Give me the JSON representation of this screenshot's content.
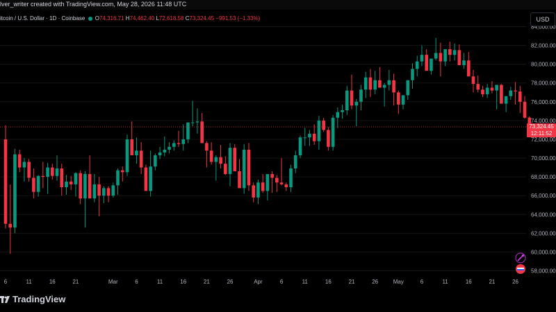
{
  "header": {
    "credit": "lver_writer created with TradingView.com, May 28, 2026 11:48 UTC"
  },
  "legend": {
    "symbol": "itcoin / U.S. Dollar · 1D · Coinbase",
    "o_label": "O",
    "o_value": "74,316.71",
    "h_label": "H",
    "h_value": "74,462.40",
    "l_label": "L",
    "l_value": "72,618.58",
    "c_label": "C",
    "c_value": "73,324.45",
    "change": "−991.53 (−1.33%)"
  },
  "currency": "USD",
  "price_box": {
    "price": "73,324.45",
    "countdown": "12:11:52"
  },
  "brand": {
    "name": "TradingView"
  },
  "colors": {
    "up": "#089981",
    "down": "#f23645",
    "background": "#000000",
    "text": "#d1d4dc"
  },
  "icons": [
    "tradingview-logo-icon",
    "magic-wand-icon",
    "flag-icon"
  ],
  "chart_data": {
    "type": "candlestick",
    "yaxis_ticks": [
      "84,000.00",
      "82,000.00",
      "80,000.00",
      "78,000.00",
      "76,000.00",
      "74,000.00",
      "72,000.00",
      "70,000.00",
      "68,000.00",
      "66,000.00",
      "64,000.00",
      "62,000.00",
      "60,000.00",
      "58,000.00"
    ],
    "yaxis_values": [
      84000,
      82000,
      80000,
      78000,
      76000,
      74000,
      72000,
      70000,
      68000,
      66000,
      64000,
      62000,
      60000,
      58000
    ],
    "ylim": [
      57300,
      84300
    ],
    "xaxis_ticks": [
      {
        "label": "6",
        "idx": 0
      },
      {
        "label": "11",
        "idx": 5
      },
      {
        "label": "16",
        "idx": 10
      },
      {
        "label": "21",
        "idx": 15
      },
      {
        "label": "Mar",
        "idx": 23
      },
      {
        "label": "6",
        "idx": 28
      },
      {
        "label": "11",
        "idx": 33
      },
      {
        "label": "16",
        "idx": 38
      },
      {
        "label": "21",
        "idx": 43
      },
      {
        "label": "26",
        "idx": 48
      },
      {
        "label": "Apr",
        "idx": 54
      },
      {
        "label": "6",
        "idx": 59
      },
      {
        "label": "11",
        "idx": 64
      },
      {
        "label": "16",
        "idx": 69
      },
      {
        "label": "21",
        "idx": 74
      },
      {
        "label": "26",
        "idx": 79
      },
      {
        "label": "May",
        "idx": 84
      },
      {
        "label": "6",
        "idx": 89
      },
      {
        "label": "11",
        "idx": 94
      },
      {
        "label": "16",
        "idx": 99
      },
      {
        "label": "21",
        "idx": 104
      },
      {
        "label": "26",
        "idx": 109
      }
    ],
    "last_price": 73324.45,
    "candles": [
      [
        72000,
        73500,
        62500,
        63000
      ],
      [
        63000,
        67200,
        59800,
        62600
      ],
      [
        62600,
        71000,
        62000,
        70400
      ],
      [
        70400,
        70900,
        68500,
        69000
      ],
      [
        69000,
        70000,
        67500,
        69600
      ],
      [
        69600,
        69900,
        67500,
        67900
      ],
      [
        67900,
        68900,
        65700,
        66400
      ],
      [
        66400,
        68200,
        65900,
        68100
      ],
      [
        68100,
        69600,
        66800,
        68000
      ],
      [
        68000,
        69500,
        66200,
        69000
      ],
      [
        69000,
        69400,
        67700,
        68100
      ],
      [
        68100,
        70300,
        67600,
        68900
      ],
      [
        68900,
        69400,
        66000,
        66900
      ],
      [
        66900,
        68200,
        66100,
        67500
      ],
      [
        67500,
        68100,
        66600,
        67200
      ],
      [
        67200,
        68500,
        65900,
        68400
      ],
      [
        68400,
        68700,
        65100,
        65700
      ],
      [
        65700,
        68600,
        62600,
        68300
      ],
      [
        68300,
        70300,
        65800,
        65700
      ],
      [
        65700,
        68300,
        65300,
        67200
      ],
      [
        67200,
        68000,
        63800,
        66000
      ],
      [
        66000,
        67000,
        65200,
        66800
      ],
      [
        66800,
        67000,
        65300,
        66000
      ],
      [
        66000,
        67400,
        65800,
        67100
      ],
      [
        67100,
        68900,
        66100,
        68700
      ],
      [
        68700,
        69100,
        67500,
        68500
      ],
      [
        68500,
        72500,
        68100,
        72000
      ],
      [
        72000,
        73900,
        71100,
        70300
      ],
      [
        70300,
        72200,
        69400,
        70800
      ],
      [
        70800,
        71700,
        68300,
        69000
      ],
      [
        69000,
        69300,
        66500,
        66500
      ],
      [
        66500,
        70800,
        65900,
        69100
      ],
      [
        69100,
        70500,
        68700,
        70300
      ],
      [
        70300,
        71200,
        69900,
        70600
      ],
      [
        70600,
        72300,
        70200,
        70900
      ],
      [
        70900,
        71700,
        70500,
        71200
      ],
      [
        71200,
        71900,
        70800,
        71600
      ],
      [
        71600,
        72900,
        71200,
        71500
      ],
      [
        71500,
        73600,
        70800,
        72000
      ],
      [
        72000,
        73500,
        71600,
        73800
      ],
      [
        73800,
        76100,
        73400,
        73800
      ],
      [
        73800,
        75300,
        72600,
        73900
      ],
      [
        73900,
        74800,
        71600,
        71600
      ],
      [
        71600,
        71800,
        69000,
        70800
      ],
      [
        70800,
        71700,
        69300,
        69600
      ],
      [
        69600,
        70300,
        67600,
        70100
      ],
      [
        70100,
        71400,
        68900,
        69400
      ],
      [
        69400,
        70200,
        68200,
        68300
      ],
      [
        68300,
        71600,
        67000,
        71100
      ],
      [
        71100,
        71500,
        68700,
        68600
      ],
      [
        68600,
        69900,
        67200,
        66800
      ],
      [
        66800,
        71500,
        66200,
        70900
      ],
      [
        70900,
        71600,
        66500,
        67100
      ],
      [
        67100,
        67400,
        65300,
        65800
      ],
      [
        65800,
        67700,
        65100,
        67400
      ],
      [
        67400,
        68300,
        66300,
        66500
      ],
      [
        66500,
        67300,
        65500,
        68300
      ],
      [
        68300,
        68600,
        66300,
        67900
      ],
      [
        67900,
        68200,
        66400,
        67400
      ],
      [
        67400,
        70000,
        67100,
        67200
      ],
      [
        67200,
        67400,
        66500,
        66900
      ],
      [
        66900,
        69300,
        66400,
        68900
      ],
      [
        68900,
        70800,
        68400,
        70300
      ],
      [
        70300,
        72400,
        70000,
        72200
      ],
      [
        72200,
        73200,
        71300,
        72200
      ],
      [
        72200,
        73000,
        71300,
        72600
      ],
      [
        72600,
        73600,
        71400,
        71800
      ],
      [
        71800,
        74500,
        70900,
        74000
      ],
      [
        74000,
        74300,
        72800,
        73000
      ],
      [
        73000,
        73300,
        70800,
        71200
      ],
      [
        71200,
        74600,
        70800,
        74300
      ],
      [
        74300,
        75400,
        73200,
        74900
      ],
      [
        74900,
        75700,
        74200,
        75100
      ],
      [
        75100,
        77700,
        74600,
        77200
      ],
      [
        77200,
        78900,
        75200,
        75600
      ],
      [
        75600,
        76300,
        73400,
        76000
      ],
      [
        76000,
        77800,
        75100,
        77300
      ],
      [
        77300,
        79200,
        76400,
        78600
      ],
      [
        78600,
        79500,
        76500,
        77300
      ],
      [
        77300,
        79300,
        76800,
        78300
      ],
      [
        78300,
        79700,
        77500,
        77500
      ],
      [
        77500,
        78000,
        75500,
        77800
      ],
      [
        77800,
        79400,
        77200,
        78300
      ],
      [
        78300,
        79000,
        75600,
        77000
      ],
      [
        77000,
        77200,
        74700,
        75700
      ],
      [
        75700,
        76500,
        75200,
        76700
      ],
      [
        76700,
        78300,
        76200,
        78300
      ],
      [
        78300,
        80100,
        77400,
        79500
      ],
      [
        79500,
        80900,
        78700,
        80300
      ],
      [
        80300,
        82000,
        79800,
        81000
      ],
      [
        81000,
        81600,
        79500,
        79300
      ],
      [
        79300,
        80200,
        78900,
        80600
      ],
      [
        80600,
        82800,
        80400,
        81200
      ],
      [
        81200,
        82300,
        78700,
        80300
      ],
      [
        80300,
        81500,
        79800,
        81600
      ],
      [
        81600,
        82400,
        80300,
        81000
      ],
      [
        81000,
        82200,
        80400,
        81500
      ],
      [
        81500,
        82100,
        80000,
        79900
      ],
      [
        79900,
        81200,
        79500,
        80400
      ],
      [
        80400,
        81300,
        80000,
        78700
      ],
      [
        78700,
        79400,
        77000,
        77900
      ],
      [
        77900,
        78800,
        77000,
        77300
      ],
      [
        77300,
        77700,
        76500,
        76800
      ],
      [
        76800,
        77900,
        76400,
        77500
      ],
      [
        77500,
        78200,
        76900,
        77200
      ],
      [
        77200,
        77600,
        75200,
        77800
      ],
      [
        77800,
        77900,
        76000,
        75800
      ],
      [
        75800,
        76400,
        74900,
        76600
      ],
      [
        76600,
        77600,
        76200,
        77200
      ],
      [
        77200,
        78100,
        75700,
        77100
      ],
      [
        77100,
        77700,
        74800,
        76000
      ],
      [
        76000,
        76600,
        74200,
        74300
      ],
      [
        74316.71,
        74462.4,
        72618.58,
        73324.45
      ]
    ]
  }
}
